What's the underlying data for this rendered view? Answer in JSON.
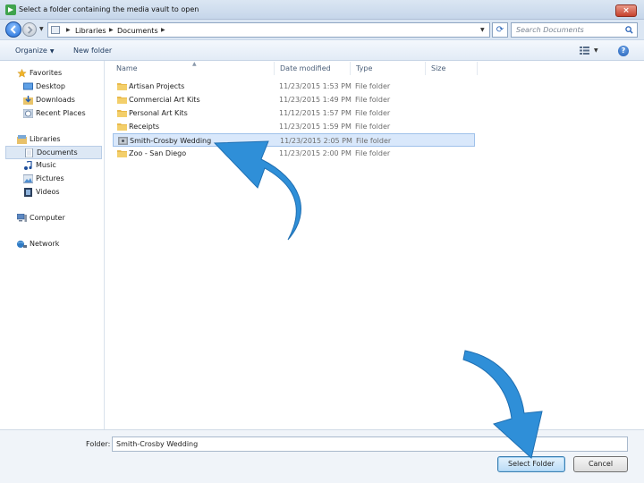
{
  "window": {
    "title": "Select a folder containing the media vault to open",
    "close_label": "×"
  },
  "address": {
    "crumbs": [
      "Libraries",
      "Documents"
    ]
  },
  "search": {
    "placeholder": "Search Documents"
  },
  "toolbar": {
    "organize_label": "Organize",
    "new_folder_label": "New folder",
    "help_label": "?"
  },
  "nav": {
    "groups": [
      {
        "label": "Favorites",
        "icon": "star-icon",
        "items": [
          {
            "label": "Desktop",
            "icon": "desktop-icon"
          },
          {
            "label": "Downloads",
            "icon": "downloads-icon"
          },
          {
            "label": "Recent Places",
            "icon": "recent-places-icon"
          }
        ]
      },
      {
        "label": "Libraries",
        "icon": "libraries-icon",
        "items": [
          {
            "label": "Documents",
            "icon": "documents-icon",
            "selected": true
          },
          {
            "label": "Music",
            "icon": "music-icon"
          },
          {
            "label": "Pictures",
            "icon": "pictures-icon"
          },
          {
            "label": "Videos",
            "icon": "videos-icon"
          }
        ]
      },
      {
        "label": "Computer",
        "icon": "computer-icon",
        "items": []
      },
      {
        "label": "Network",
        "icon": "network-icon",
        "items": []
      }
    ]
  },
  "columns": {
    "name": "Name",
    "date": "Date modified",
    "type": "Type",
    "size": "Size"
  },
  "files": [
    {
      "name": "Artisan Projects",
      "date": "11/23/2015 1:53 PM",
      "type": "File folder"
    },
    {
      "name": "Commercial Art Kits",
      "date": "11/23/2015 1:49 PM",
      "type": "File folder"
    },
    {
      "name": "Personal Art Kits",
      "date": "11/12/2015 1:57 PM",
      "type": "File folder"
    },
    {
      "name": "Receipts",
      "date": "11/23/2015 1:59 PM",
      "type": "File folder"
    },
    {
      "name": "Smith-Crosby Wedding",
      "date": "11/23/2015 2:05 PM",
      "type": "File folder",
      "selected": true
    },
    {
      "name": "Zoo - San Diego",
      "date": "11/23/2015 2:00 PM",
      "type": "File folder"
    }
  ],
  "bottom": {
    "folder_label": "Folder:",
    "folder_value": "Smith-Crosby Wedding",
    "select_label": "Select Folder",
    "cancel_label": "Cancel"
  },
  "colors": {
    "annotation_arrow": "#2f8fd8",
    "selection": "#d9e8fb"
  }
}
